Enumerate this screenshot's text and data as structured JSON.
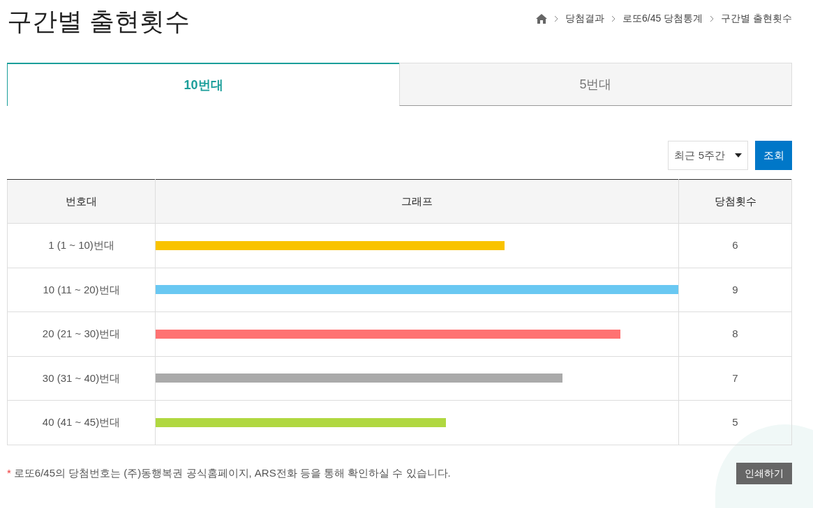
{
  "title": "구간별 출현횟수",
  "breadcrumb": [
    "당첨결과",
    "로또6/45 당첨통계",
    "구간별 출현횟수"
  ],
  "tabs": [
    {
      "label": "10번대",
      "selected": true
    },
    {
      "label": "5번대",
      "selected": false
    }
  ],
  "period_select": {
    "value": "최근 5주간"
  },
  "search_button": "조회",
  "table": {
    "columns": [
      "번호대",
      "그래프",
      "당첨횟수"
    ],
    "rows": [
      {
        "range": "1 (1 ~ 10)번대",
        "level": 0.667,
        "color": "#f9c300",
        "count": "6"
      },
      {
        "range": "10 (11 ~ 20)번대",
        "level": 1,
        "color": "#69c8f2",
        "count": "9"
      },
      {
        "range": "20 (21 ~ 30)번대",
        "level": 0.889,
        "color": "#ff7272",
        "count": "8"
      },
      {
        "range": "30 (31 ~ 40)번대",
        "level": 0.778,
        "color": "#aaaaaa",
        "count": "7"
      },
      {
        "range": "40 (41 ~ 45)번대",
        "level": 0.556,
        "color": "#b0d840",
        "count": "5"
      }
    ]
  },
  "note_mark": "*",
  "note": "로또6/45의 당첨번호는 (주)동행복권 공식홈페이지, ARS전화 등을 통해 확인하실 수 있습니다.",
  "print_button": "인쇄하기"
}
